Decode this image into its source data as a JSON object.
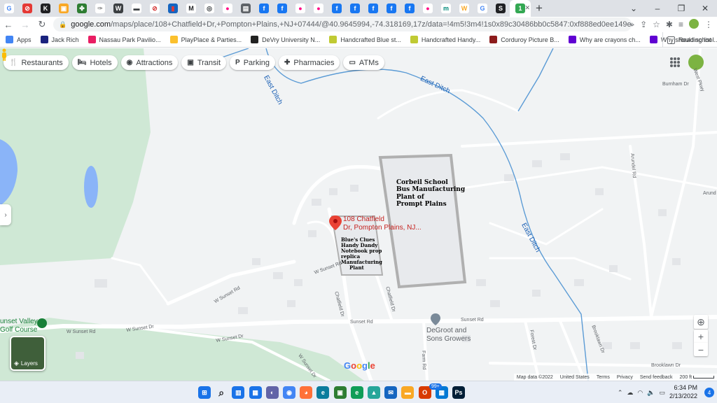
{
  "browser": {
    "tabs": [
      {
        "icon": "google-g-icon",
        "color": "#ffffff",
        "glyph": "G",
        "glyph_color": "#4285f4"
      },
      {
        "icon": "red-circle-icon",
        "color": "#e53935",
        "glyph": "⊘",
        "glyph_color": "#ffffff"
      },
      {
        "icon": "k-icon",
        "color": "#202124",
        "glyph": "K",
        "glyph_color": "#ffffff"
      },
      {
        "icon": "yellow-bag-icon",
        "color": "#f9a825",
        "glyph": "▣",
        "glyph_color": "#ffffff"
      },
      {
        "icon": "green-clover-icon",
        "color": "#2e7d32",
        "glyph": "✤",
        "glyph_color": "#ffffff"
      },
      {
        "icon": "feather-icon",
        "color": "#ffffff",
        "glyph": "✑",
        "glyph_color": "#9e9e9e"
      },
      {
        "icon": "wordpress-icon",
        "color": "#3c4043",
        "glyph": "W",
        "glyph_color": "#ffffff"
      },
      {
        "icon": "car-icon",
        "color": "#ffffff",
        "glyph": "▬",
        "glyph_color": "#3c4043"
      },
      {
        "icon": "no-sign-icon",
        "color": "#ffffff",
        "glyph": "⊘",
        "glyph_color": "#d32f2f"
      },
      {
        "icon": "flag-icon",
        "color": "#1565c0",
        "glyph": "▮",
        "glyph_color": "#e53935"
      },
      {
        "icon": "m-logo-icon",
        "color": "#ffffff",
        "glyph": "M",
        "glyph_color": "#202124"
      },
      {
        "icon": "compass-icon",
        "color": "#ffffff",
        "glyph": "◎",
        "glyph_color": "#3c4043"
      },
      {
        "icon": "flickr-icon",
        "color": "#ffffff",
        "glyph": "●",
        "glyph_color": "#ff0084"
      },
      {
        "icon": "film-icon",
        "color": "#5f6368",
        "glyph": "▤",
        "glyph_color": "#ffffff"
      },
      {
        "icon": "facebook-icon",
        "color": "#1877f2",
        "glyph": "f",
        "glyph_color": "#ffffff"
      },
      {
        "icon": "facebook-icon",
        "color": "#1877f2",
        "glyph": "f",
        "glyph_color": "#ffffff"
      },
      {
        "icon": "flickr-icon",
        "color": "#ffffff",
        "glyph": "●",
        "glyph_color": "#ff0084"
      },
      {
        "icon": "flickr-icon",
        "color": "#ffffff",
        "glyph": "●",
        "glyph_color": "#ff0084"
      },
      {
        "icon": "facebook-icon",
        "color": "#1877f2",
        "glyph": "f",
        "glyph_color": "#ffffff"
      },
      {
        "icon": "facebook-icon",
        "color": "#1877f2",
        "glyph": "f",
        "glyph_color": "#ffffff"
      },
      {
        "icon": "facebook-icon",
        "color": "#1877f2",
        "glyph": "f",
        "glyph_color": "#ffffff"
      },
      {
        "icon": "facebook-icon",
        "color": "#1877f2",
        "glyph": "f",
        "glyph_color": "#ffffff"
      },
      {
        "icon": "facebook-icon",
        "color": "#1877f2",
        "glyph": "f",
        "glyph_color": "#ffffff"
      },
      {
        "icon": "flickr-icon",
        "color": "#ffffff",
        "glyph": "●",
        "glyph_color": "#ff0084"
      },
      {
        "icon": "mu-icon",
        "color": "#ffffff",
        "glyph": "m",
        "glyph_color": "#00897b"
      },
      {
        "icon": "w-icon",
        "color": "#ffffff",
        "glyph": "W",
        "glyph_color": "#f9a825"
      },
      {
        "icon": "google-g-icon",
        "color": "#ffffff",
        "glyph": "G",
        "glyph_color": "#4285f4"
      },
      {
        "icon": "s-icon",
        "color": "#202124",
        "glyph": "S",
        "glyph_color": "#ffffff"
      }
    ],
    "active_tab": {
      "icon": "google-maps-icon",
      "glyph": "1"
    },
    "url_host": "google.com",
    "url_rest": "/maps/place/108+Chatfield+Dr,+Pompton+Plains,+NJ+07444/@40.9645994,-74.318169,17z/data=!4m5!3m4!1s0x89c30486bb0c5847:0xf888ed0ee149e77e!8m2!3d40.9643159!4...",
    "bookmarks": [
      {
        "label": "Apps",
        "icon": "apps-grid-icon",
        "color": "#4285f4"
      },
      {
        "label": "Jack Rich",
        "icon": "jack-rich-icon",
        "color": "#1a237e"
      },
      {
        "label": "Nassau Park Pavilio...",
        "icon": "nassau-icon",
        "color": "#e91e63"
      },
      {
        "label": "PlayPlace & Parties...",
        "icon": "mcdonalds-icon",
        "color": "#fbc02d"
      },
      {
        "label": "DeVry University N...",
        "icon": "devry-icon",
        "color": "#212121"
      },
      {
        "label": "Handcrafted Blue st...",
        "icon": "etsy-icon",
        "color": "#c0ca33"
      },
      {
        "label": "Handcrafted Handy...",
        "icon": "etsy-icon",
        "color": "#c0ca33"
      },
      {
        "label": "Corduroy Picture B...",
        "icon": "corduroy-icon",
        "color": "#8d1c1c"
      },
      {
        "label": "Why are crayons ch...",
        "icon": "yahoo-icon",
        "color": "#6001d2"
      },
      {
        "label": "Why should school...",
        "icon": "yahoo-icon",
        "color": "#6001d2"
      }
    ],
    "reading_list": "Reading list"
  },
  "map": {
    "chips": [
      {
        "label": "Restaurants",
        "icon": "fork-knife-icon",
        "glyph": "🍴"
      },
      {
        "label": "Hotels",
        "icon": "bed-icon",
        "glyph": "🛏"
      },
      {
        "label": "Attractions",
        "icon": "camera-icon",
        "glyph": "◉"
      },
      {
        "label": "Transit",
        "icon": "bus-icon",
        "glyph": "▣"
      },
      {
        "label": "Parking",
        "icon": "parking-icon",
        "glyph": "P"
      },
      {
        "label": "Pharmacies",
        "icon": "pharmacy-icon",
        "glyph": "✚"
      },
      {
        "label": "ATMs",
        "icon": "atm-icon",
        "glyph": "▭"
      }
    ],
    "water_labels": [
      "East Ditch",
      "East Ditch",
      "East Ditch"
    ],
    "road_labels": {
      "burnham": "Burnham Dr",
      "west_pkwy": "West Pkwy",
      "arundel": "Arundel Rd",
      "arund_partial": "Arund",
      "w_sunset_rd_1": "W Sunset Rd",
      "w_sunset_rd_2": "W Sunset Rd",
      "w_sunset_rd_3": "W Sunset Rd",
      "w_sunset_dr_1": "W Sunset Dr",
      "w_sunset_dr_2": "W Sunset Dr",
      "w_sunset_dr_3": "W Sunset Dr",
      "chatfield": "Chatfield Dr",
      "sunset_rd_1": "Sunset Rd",
      "sunset_rd_2": "Sunset Rd",
      "farm_rd": "Farm Rd",
      "forest_dr": "Forest Dr",
      "brooklawn_dr": "Brooklawn Dr",
      "brooklawn_dr_2": "Brooklawn Dr"
    },
    "annotation_corbeil": [
      "Corbeil School",
      "Bus Manufacturing",
      "Plant of",
      "Prompt Plains"
    ],
    "annotation_blues": [
      "Blue's Clues",
      "Handy Dandy",
      "Notebook prop",
      "replica",
      "Manufacturing",
      "Plant"
    ],
    "pin_label": [
      "108 Chatfield",
      "Dr, Pompton Plains, NJ..."
    ],
    "poi_degroot": [
      "DeGroot and",
      "Sons Growers"
    ],
    "poi_golf": [
      "unset Valley",
      "Golf Course"
    ],
    "layers_label": "Layers",
    "google_logo": [
      "G",
      "o",
      "o",
      "g",
      "l",
      "e"
    ],
    "google_logo_colors": [
      "#4285f4",
      "#ea4335",
      "#fbbc05",
      "#4285f4",
      "#34a853",
      "#ea4335"
    ],
    "footer": {
      "map_data": "Map data ©2022",
      "country": "United States",
      "terms": "Terms",
      "privacy": "Privacy",
      "feedback": "Send feedback",
      "scale": "200 ft"
    },
    "colors": {
      "water": "#5b9bd5",
      "park": "#cce8d4",
      "pin": "#ea4335",
      "annotation_outline": "#b0b0b0"
    }
  },
  "taskbar": {
    "icons": [
      {
        "icon": "windows-start-icon",
        "color": "#1a73e8",
        "glyph": "⊞"
      },
      {
        "icon": "search-icon",
        "color": "#e9eef6",
        "glyph": "⌕"
      },
      {
        "icon": "task-view-icon",
        "color": "#1a73e8",
        "glyph": "▥"
      },
      {
        "icon": "widgets-icon",
        "color": "#1a73e8",
        "glyph": "▦"
      },
      {
        "icon": "teams-chat-icon",
        "color": "#6264a7",
        "glyph": "◐"
      },
      {
        "icon": "chrome-icon",
        "color": "#4285f4",
        "glyph": "◉"
      },
      {
        "icon": "firefox-icon",
        "color": "#ff7139",
        "glyph": "◕"
      },
      {
        "icon": "edge-icon",
        "color": "#0c7d9d",
        "glyph": "e"
      },
      {
        "icon": "android-icon",
        "color": "#2e7d32",
        "glyph": "▣"
      },
      {
        "icon": "edge-dev-icon",
        "color": "#0f9d58",
        "glyph": "e"
      },
      {
        "icon": "photos-icon",
        "color": "#26a69a",
        "glyph": "▲"
      },
      {
        "icon": "mail-icon",
        "color": "#1565c0",
        "glyph": "✉"
      },
      {
        "icon": "file-explorer-icon",
        "color": "#f9a825",
        "glyph": "▬"
      },
      {
        "icon": "office-icon",
        "color": "#d83b01",
        "glyph": "O"
      },
      {
        "icon": "store-icon",
        "color": "#0078d4",
        "glyph": "▦"
      },
      {
        "icon": "photoshop-icon",
        "color": "#001e36",
        "glyph": "Ps"
      }
    ],
    "badge": "99+",
    "time": "6:34 PM",
    "date": "2/13/2022",
    "notification_count": "4"
  }
}
